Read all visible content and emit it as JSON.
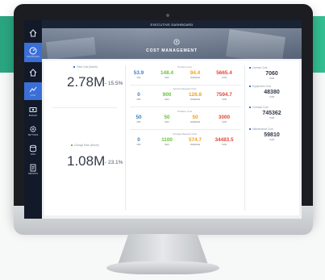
{
  "header": {
    "title": "EXECUTIVE DASHBOARD"
  },
  "banner": {
    "title": "COST MANAGEMENT"
  },
  "sidebar": {
    "items": [
      {
        "icon": "home-icon",
        "label": ""
      },
      {
        "icon": "gauge-icon",
        "label": "DASHBOARD"
      },
      {
        "icon": "home-icon",
        "label": ""
      },
      {
        "icon": "chart-icon",
        "label": "COST"
      },
      {
        "icon": "money-icon",
        "label": "BUDGET"
      },
      {
        "icon": "gear-icon",
        "label": "SETTINGS"
      },
      {
        "icon": "database-icon",
        "label": "DATA"
      },
      {
        "icon": "report-icon",
        "label": "REPORTS"
      }
    ]
  },
  "left": {
    "cost_label": "Total Cost (Month)",
    "cost_value": "2.78M",
    "cost_change": "- 15.5%",
    "charge_label": "Change Rate (Month)",
    "charge_value": "1.08M",
    "charge_change": "- 23.1%"
  },
  "sections": [
    {
      "title": "Product Cost",
      "metrics": [
        {
          "value": "53.9",
          "key": "MIN"
        },
        {
          "value": "148.4",
          "key": "MAX"
        },
        {
          "value": "94.4",
          "key": "AVERAGE"
        },
        {
          "value": "5665.4",
          "key": "SUM"
        }
      ]
    },
    {
      "title": "Service Request Cost",
      "metrics": [
        {
          "value": "0",
          "key": "MIN"
        },
        {
          "value": "900",
          "key": "MAX"
        },
        {
          "value": "126.8",
          "key": "AVERAGE"
        },
        {
          "value": "7594.7",
          "key": "SUM"
        }
      ]
    },
    {
      "title": "Problem Cost",
      "metrics": [
        {
          "value": "50",
          "key": "MIN"
        },
        {
          "value": "50",
          "key": "MAX"
        },
        {
          "value": "50",
          "key": "AVERAGE"
        },
        {
          "value": "3000",
          "key": "SUM"
        }
      ]
    },
    {
      "title": "Change Request Cost",
      "metrics": [
        {
          "value": "0",
          "key": "MIN"
        },
        {
          "value": "1100",
          "key": "MAX"
        },
        {
          "value": "574.7",
          "key": "AVERAGE"
        },
        {
          "value": "34483.5",
          "key": "SUM"
        }
      ]
    }
  ],
  "right": [
    {
      "title": "License Cost",
      "value": "7060",
      "key": "SUM"
    },
    {
      "title": "Equipment Cost",
      "value": "48380",
      "key": "SUM"
    },
    {
      "title": "Contract Cost",
      "value": "745362",
      "key": "SUM"
    },
    {
      "title": "Maintenance Cost",
      "value": "59810",
      "key": "SUM"
    }
  ],
  "colors": {
    "min": "#3b82c6",
    "max": "#6bbf3b",
    "average": "#f0a020",
    "sum": "#e2463a",
    "sidebar_active": "#3a6fd8",
    "page_accent": "#2fb68a"
  }
}
